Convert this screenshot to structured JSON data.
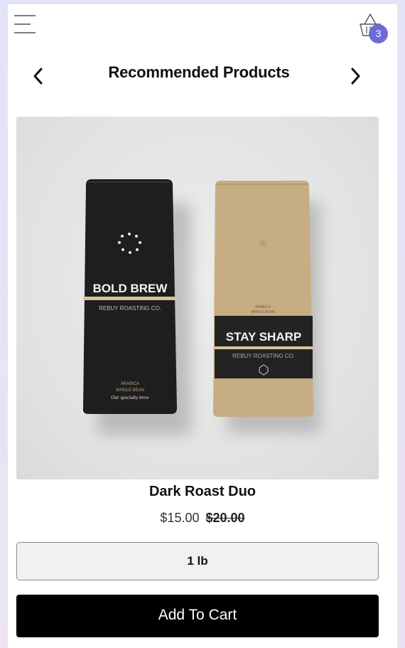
{
  "header": {
    "cart_count": "3",
    "title": "Recommended Products"
  },
  "product": {
    "name": "Dark Roast Duo",
    "price": "$15.00",
    "original_price": "$20.00",
    "image": {
      "left_bag": {
        "brand": "BOLD BREW",
        "roaster": "REBUY ROASTING CO.",
        "origin": "ARABICA",
        "bean": "WHOLE BEAN",
        "tagline": "Our specialty brew"
      },
      "right_bag": {
        "brand": "STAY SHARP",
        "roaster": "REBUY ROASTING CO.",
        "origin": "ARABICA",
        "bean": "WHOLE BEAN"
      }
    }
  },
  "options": {
    "size_selected": "1 lb"
  },
  "actions": {
    "add_to_cart": "Add To Cart"
  },
  "colors": {
    "badge": "#6d6cd6",
    "button": "#000000",
    "dark_bag": "#1e1e1e",
    "kraft_bag": "#c7ad82",
    "accent_stripe": "#d8c29a"
  }
}
